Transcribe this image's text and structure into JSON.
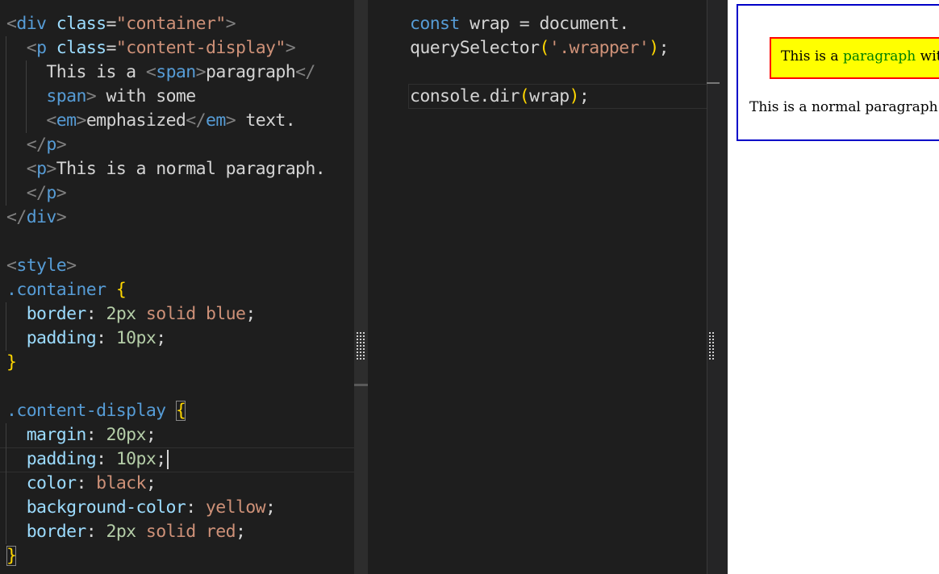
{
  "html_editor": {
    "lines": [
      [
        {
          "t": "<",
          "c": "t-bracket"
        },
        {
          "t": "div",
          "c": "t-tag"
        },
        {
          "t": " ",
          "c": "t-text"
        },
        {
          "t": "class",
          "c": "t-attr"
        },
        {
          "t": "=",
          "c": "t-text"
        },
        {
          "t": "\"container\"",
          "c": "t-str"
        },
        {
          "t": ">",
          "c": "t-bracket"
        }
      ],
      [
        {
          "ind": 1
        },
        {
          "t": "<",
          "c": "t-bracket"
        },
        {
          "t": "p",
          "c": "t-tag"
        },
        {
          "t": " ",
          "c": "t-text"
        },
        {
          "t": "class",
          "c": "t-attr"
        },
        {
          "t": "=",
          "c": "t-text"
        },
        {
          "t": "\"content-display\"",
          "c": "t-str"
        },
        {
          "t": ">",
          "c": "t-bracket"
        }
      ],
      [
        {
          "ind": 2
        },
        {
          "t": "This is a ",
          "c": "t-text"
        },
        {
          "t": "<",
          "c": "t-bracket"
        },
        {
          "t": "span",
          "c": "t-tag"
        },
        {
          "t": ">",
          "c": "t-bracket"
        },
        {
          "t": "paragraph",
          "c": "t-text"
        },
        {
          "t": "</",
          "c": "t-bracket"
        }
      ],
      [
        {
          "ind": 2
        },
        {
          "t": "span",
          "c": "t-tag"
        },
        {
          "t": ">",
          "c": "t-bracket"
        },
        {
          "t": " with some",
          "c": "t-text"
        }
      ],
      [
        {
          "ind": 2
        },
        {
          "t": "<",
          "c": "t-bracket"
        },
        {
          "t": "em",
          "c": "t-tag"
        },
        {
          "t": ">",
          "c": "t-bracket"
        },
        {
          "t": "emphasized",
          "c": "t-text"
        },
        {
          "t": "</",
          "c": "t-bracket"
        },
        {
          "t": "em",
          "c": "t-tag"
        },
        {
          "t": ">",
          "c": "t-bracket"
        },
        {
          "t": " text.",
          "c": "t-text"
        }
      ],
      [
        {
          "ind": 1
        },
        {
          "t": "</",
          "c": "t-bracket"
        },
        {
          "t": "p",
          "c": "t-tag"
        },
        {
          "t": ">",
          "c": "t-bracket"
        }
      ],
      [
        {
          "ind": 1
        },
        {
          "t": "<",
          "c": "t-bracket"
        },
        {
          "t": "p",
          "c": "t-tag"
        },
        {
          "t": ">",
          "c": "t-bracket"
        },
        {
          "t": "This is a normal paragraph.",
          "c": "t-text"
        }
      ],
      [
        {
          "ind": 1
        },
        {
          "t": "</",
          "c": "t-bracket"
        },
        {
          "t": "p",
          "c": "t-tag"
        },
        {
          "t": ">",
          "c": "t-bracket"
        }
      ],
      [
        {
          "t": "</",
          "c": "t-bracket"
        },
        {
          "t": "div",
          "c": "t-tag"
        },
        {
          "t": ">",
          "c": "t-bracket"
        }
      ],
      [],
      [
        {
          "t": "<",
          "c": "t-bracket"
        },
        {
          "t": "style",
          "c": "t-tag"
        },
        {
          "t": ">",
          "c": "t-bracket"
        }
      ],
      [
        {
          "t": ".container",
          "c": "t-sel"
        },
        {
          "t": " ",
          "c": "t-text"
        },
        {
          "t": "{",
          "c": "t-brace"
        }
      ],
      [
        {
          "ind": 1
        },
        {
          "t": "border",
          "c": "t-prop"
        },
        {
          "t": ": ",
          "c": "t-text"
        },
        {
          "t": "2px",
          "c": "t-num"
        },
        {
          "t": " solid blue",
          "c": "t-str"
        },
        {
          "t": ";",
          "c": "t-text"
        }
      ],
      [
        {
          "ind": 1
        },
        {
          "t": "padding",
          "c": "t-prop"
        },
        {
          "t": ": ",
          "c": "t-text"
        },
        {
          "t": "10px",
          "c": "t-num"
        },
        {
          "t": ";",
          "c": "t-text"
        }
      ],
      [
        {
          "t": "}",
          "c": "t-brace"
        }
      ],
      [],
      [
        {
          "t": ".content-display",
          "c": "t-sel"
        },
        {
          "t": " ",
          "c": "t-text"
        },
        {
          "t": "{",
          "c": "t-brace",
          "box": true
        }
      ],
      [
        {
          "ind": 1
        },
        {
          "t": "margin",
          "c": "t-prop"
        },
        {
          "t": ": ",
          "c": "t-text"
        },
        {
          "t": "20px",
          "c": "t-num"
        },
        {
          "t": ";",
          "c": "t-text"
        }
      ],
      [
        {
          "ind": 1
        },
        {
          "t": "padding",
          "c": "t-prop"
        },
        {
          "t": ": ",
          "c": "t-text"
        },
        {
          "t": "10px",
          "c": "t-num"
        },
        {
          "t": ";",
          "c": "t-text"
        },
        {
          "caret": true
        }
      ],
      [
        {
          "ind": 1
        },
        {
          "t": "color",
          "c": "t-prop"
        },
        {
          "t": ": ",
          "c": "t-text"
        },
        {
          "t": "black",
          "c": "t-str"
        },
        {
          "t": ";",
          "c": "t-text"
        }
      ],
      [
        {
          "ind": 1
        },
        {
          "t": "background-color",
          "c": "t-prop"
        },
        {
          "t": ": ",
          "c": "t-text"
        },
        {
          "t": "yellow",
          "c": "t-str"
        },
        {
          "t": ";",
          "c": "t-text"
        }
      ],
      [
        {
          "ind": 1
        },
        {
          "t": "border",
          "c": "t-prop"
        },
        {
          "t": ": ",
          "c": "t-text"
        },
        {
          "t": "2px",
          "c": "t-num"
        },
        {
          "t": " solid red",
          "c": "t-str"
        },
        {
          "t": ";",
          "c": "t-text"
        }
      ],
      [
        {
          "t": "}",
          "c": "t-brace",
          "box": true
        }
      ]
    ]
  },
  "js_editor": {
    "lines": [
      [
        {
          "t": "const",
          "c": "t-kw"
        },
        {
          "t": " wrap = document.",
          "c": "t-var"
        }
      ],
      [
        {
          "t": "querySelector",
          "c": "t-var"
        },
        {
          "t": "(",
          "c": "t-paren"
        },
        {
          "t": "'.wrapper'",
          "c": "t-str"
        },
        {
          "t": ")",
          "c": "t-paren"
        },
        {
          "t": ";",
          "c": "t-punc"
        }
      ],
      [],
      [
        {
          "t": "console.dir",
          "c": "t-var"
        },
        {
          "t": "(",
          "c": "t-paren"
        },
        {
          "t": "wrap",
          "c": "t-var"
        },
        {
          "t": ")",
          "c": "t-paren"
        },
        {
          "t": ";",
          "c": "t-punc"
        }
      ]
    ]
  },
  "preview": {
    "highlight_text_before": "This is a ",
    "highlight_span_text": "paragraph",
    "highlight_text_after": " with some emphasized text.",
    "normal_text": "This is a normal paragraph."
  }
}
